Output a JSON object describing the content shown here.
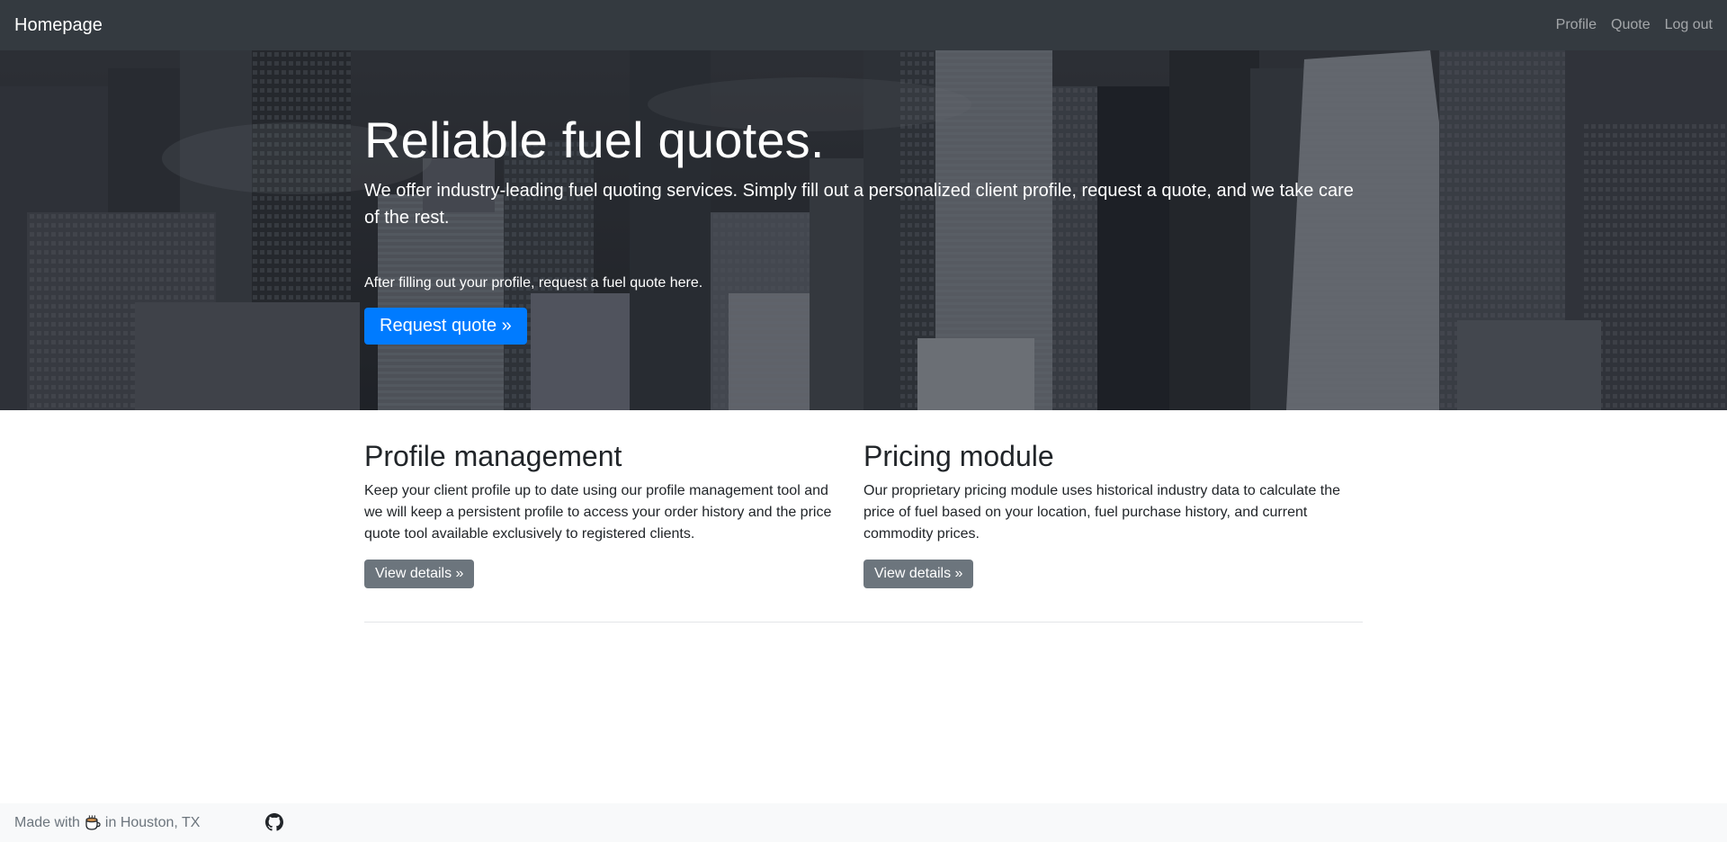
{
  "navbar": {
    "brand": "Homepage",
    "links": [
      "Profile",
      "Quote",
      "Log out"
    ]
  },
  "hero": {
    "title": "Reliable fuel quotes.",
    "lead": "We offer industry-leading fuel quoting services. Simply fill out a personalized client profile, request a quote, and we take care of the rest.",
    "note": "After filling out your profile, request a fuel quote here.",
    "button": "Request quote »"
  },
  "features": [
    {
      "title": "Profile management",
      "text": "Keep your client profile up to date using our profile management tool and we will keep a persistent profile to access your order history and the price quote tool available exclusively to registered clients.",
      "button": "View details »"
    },
    {
      "title": "Pricing module",
      "text": "Our proprietary pricing module uses historical industry data to calculate the price of fuel based on your location, fuel purchase history, and current commodity prices.",
      "button": "View details »"
    }
  ],
  "footer": {
    "made_with": "Made with",
    "location": "in Houston, TX",
    "icons": [
      "coffee-cup-icon",
      "github-icon"
    ]
  },
  "colors": {
    "navbar_bg": "#343a40",
    "primary": "#007bff",
    "secondary": "#6c757d",
    "footer_bg": "#f8f9fa"
  }
}
